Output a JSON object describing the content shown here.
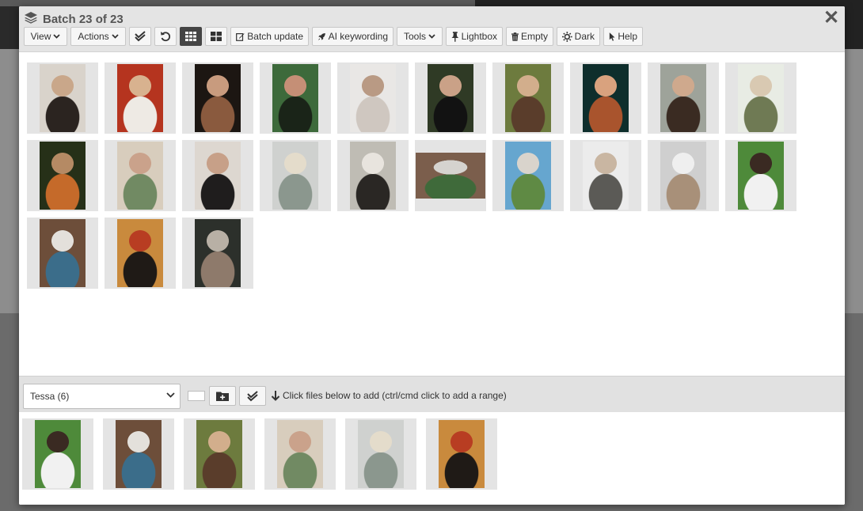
{
  "modal": {
    "title": "Batch 23 of 23"
  },
  "toolbar": {
    "view_label": "View",
    "actions_label": "Actions",
    "batch_update_label": "Batch update",
    "ai_keywording_label": "AI keywording",
    "tools_label": "Tools",
    "lightbox_label": "Lightbox",
    "empty_label": "Empty",
    "dark_label": "Dark",
    "help_label": "Help"
  },
  "collection": {
    "selected": "Tessa (6)",
    "hint": "Click files below to add (ctrl/cmd click to add a range)"
  },
  "colors": {
    "header_bg": "#e4e4e4",
    "active_button": "#444444",
    "thumb_bg": "#e4e4e4"
  },
  "batch_thumbnails": [
    {
      "orientation": "portrait",
      "colors": [
        "#d9d3cb",
        "#2b2420",
        "#c9a78a"
      ]
    },
    {
      "orientation": "portrait",
      "colors": [
        "#b5341f",
        "#eeeae4",
        "#d8b28f"
      ]
    },
    {
      "orientation": "portrait",
      "colors": [
        "#1c1612",
        "#8a5a3e",
        "#c89b7e"
      ]
    },
    {
      "orientation": "portrait",
      "colors": [
        "#3d6a3b",
        "#1a2418",
        "#c58f76"
      ]
    },
    {
      "orientation": "portrait",
      "colors": [
        "#e9e7e5",
        "#cfc7c0",
        "#b99a84"
      ]
    },
    {
      "orientation": "portrait",
      "colors": [
        "#2f3a25",
        "#121212",
        "#caa187"
      ]
    },
    {
      "orientation": "portrait",
      "colors": [
        "#6d7b3e",
        "#5a3d2b",
        "#d2ae8c"
      ]
    },
    {
      "orientation": "portrait",
      "colors": [
        "#0e2e2c",
        "#a9542d",
        "#d9a27e"
      ]
    },
    {
      "orientation": "portrait",
      "colors": [
        "#9ea39a",
        "#3a2b22",
        "#cfa98d"
      ]
    },
    {
      "orientation": "portrait",
      "colors": [
        "#e8ece4",
        "#6f7a54",
        "#d9c9b2"
      ]
    },
    {
      "orientation": "portrait",
      "colors": [
        "#263018",
        "#c56a2a",
        "#b58a64"
      ]
    },
    {
      "orientation": "portrait",
      "colors": [
        "#d8cdbd",
        "#718a63",
        "#caa28b"
      ]
    },
    {
      "orientation": "portrait",
      "colors": [
        "#ddd7d0",
        "#1f1d1d",
        "#c7a088"
      ]
    },
    {
      "orientation": "portrait",
      "colors": [
        "#cfd1cf",
        "#8b978e",
        "#e4dccb"
      ]
    },
    {
      "orientation": "portrait",
      "colors": [
        "#bfbcb4",
        "#2a2724",
        "#e8e4de"
      ]
    },
    {
      "orientation": "landscape",
      "colors": [
        "#7b5e4c",
        "#3f6a3a",
        "#d5d3cf"
      ]
    },
    {
      "orientation": "portrait",
      "colors": [
        "#66a6cf",
        "#5f8a44",
        "#d9d4cc"
      ]
    },
    {
      "orientation": "portrait",
      "colors": [
        "#ececec",
        "#5b5a56",
        "#c9b6a2"
      ]
    },
    {
      "orientation": "portrait",
      "colors": [
        "#cfcfcf",
        "#a89079",
        "#efefef"
      ]
    },
    {
      "orientation": "portrait",
      "colors": [
        "#4e8a3a",
        "#f1f1f1",
        "#3a2a22"
      ]
    },
    {
      "orientation": "portrait",
      "colors": [
        "#6d4e3a",
        "#3b6d8a",
        "#e3e0db"
      ]
    },
    {
      "orientation": "portrait",
      "colors": [
        "#c98a3d",
        "#1f1a16",
        "#b83d22"
      ]
    },
    {
      "orientation": "portrait",
      "colors": [
        "#2c302b",
        "#8e7a6b",
        "#b8b0a5"
      ]
    }
  ],
  "collection_thumbnails": [
    {
      "orientation": "portrait",
      "colors": [
        "#4e8a3a",
        "#f1f1f1",
        "#3a2a22"
      ]
    },
    {
      "orientation": "portrait",
      "colors": [
        "#6d4e3a",
        "#3b6d8a",
        "#e3e0db"
      ]
    },
    {
      "orientation": "portrait",
      "colors": [
        "#6d7b3e",
        "#5a3d2b",
        "#d2ae8c"
      ]
    },
    {
      "orientation": "portrait",
      "colors": [
        "#d8cdbd",
        "#718a63",
        "#caa28b"
      ]
    },
    {
      "orientation": "portrait",
      "colors": [
        "#cfd1cf",
        "#8b978e",
        "#e4dccb"
      ]
    },
    {
      "orientation": "portrait",
      "colors": [
        "#c98a3d",
        "#1f1a16",
        "#b83d22"
      ]
    }
  ]
}
